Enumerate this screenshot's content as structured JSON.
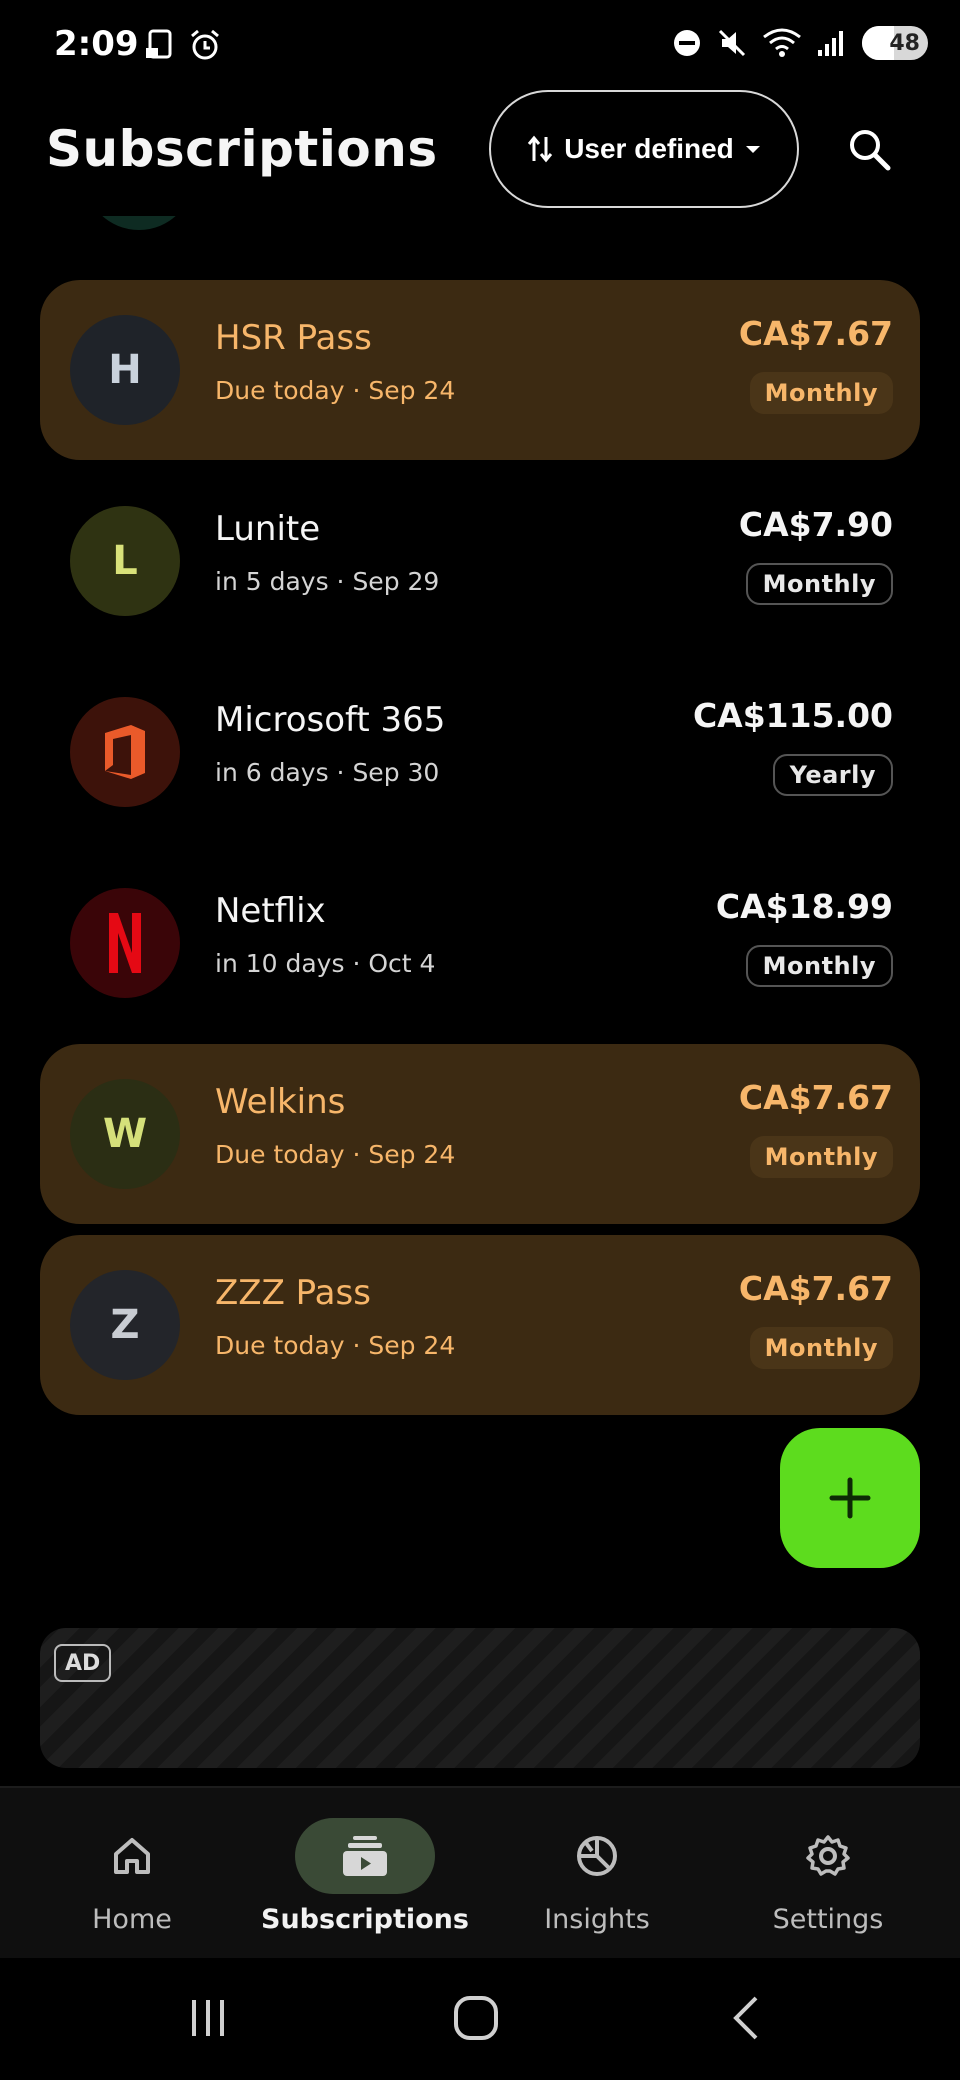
{
  "status_bar": {
    "time": "2:09",
    "battery": "48"
  },
  "header": {
    "title": "Subscriptions",
    "sort_label": "User defined"
  },
  "subscriptions": [
    {
      "initial": "H",
      "name": "HSR Pass",
      "due": "Due today · Sep 24",
      "price": "CA$7.67",
      "cycle": "Monthly",
      "state": "due",
      "avatar_bg": "#1f2329",
      "avatar_fg": "#c9d2dc"
    },
    {
      "initial": "L",
      "name": "Lunite",
      "due": "in 5 days · Sep 29",
      "price": "CA$7.90",
      "cycle": "Monthly",
      "state": "normal",
      "avatar_bg": "#2f3312",
      "avatar_fg": "#d9e27a"
    },
    {
      "name": "Microsoft 365",
      "due": "in 6 days · Sep 30",
      "price": "CA$115.00",
      "cycle": "Yearly",
      "state": "normal",
      "icon": "office-icon",
      "avatar_bg": "#3d120a",
      "avatar_fg": "#ea5a2a"
    },
    {
      "name": "Netflix",
      "due": "in 10 days · Oct 4",
      "price": "CA$18.99",
      "cycle": "Monthly",
      "state": "normal",
      "icon": "netflix-icon",
      "avatar_bg": "#3a0508",
      "avatar_fg": "#e50914"
    },
    {
      "initial": "W",
      "name": "Welkins",
      "due": "Due today · Sep 24",
      "price": "CA$7.67",
      "cycle": "Monthly",
      "state": "due",
      "avatar_bg": "#2b2e14",
      "avatar_fg": "#d5e07a"
    },
    {
      "initial": "Z",
      "name": "ZZZ Pass",
      "due": "Due today · Sep 24",
      "price": "CA$7.67",
      "cycle": "Monthly",
      "state": "due",
      "avatar_bg": "#23252a",
      "avatar_fg": "#c8ccd2"
    }
  ],
  "ad": {
    "badge": "AD"
  },
  "bottom_nav": {
    "items": [
      {
        "label": "Home",
        "icon": "home-icon"
      },
      {
        "label": "Subscriptions",
        "icon": "subscriptions-icon",
        "active": true
      },
      {
        "label": "Insights",
        "icon": "insights-icon"
      },
      {
        "label": "Settings",
        "icon": "gear-icon"
      }
    ]
  },
  "colors": {
    "accent_green": "#5ddc1e",
    "due_row_bg": "#3c2a12",
    "due_text": "#f7b66a"
  }
}
